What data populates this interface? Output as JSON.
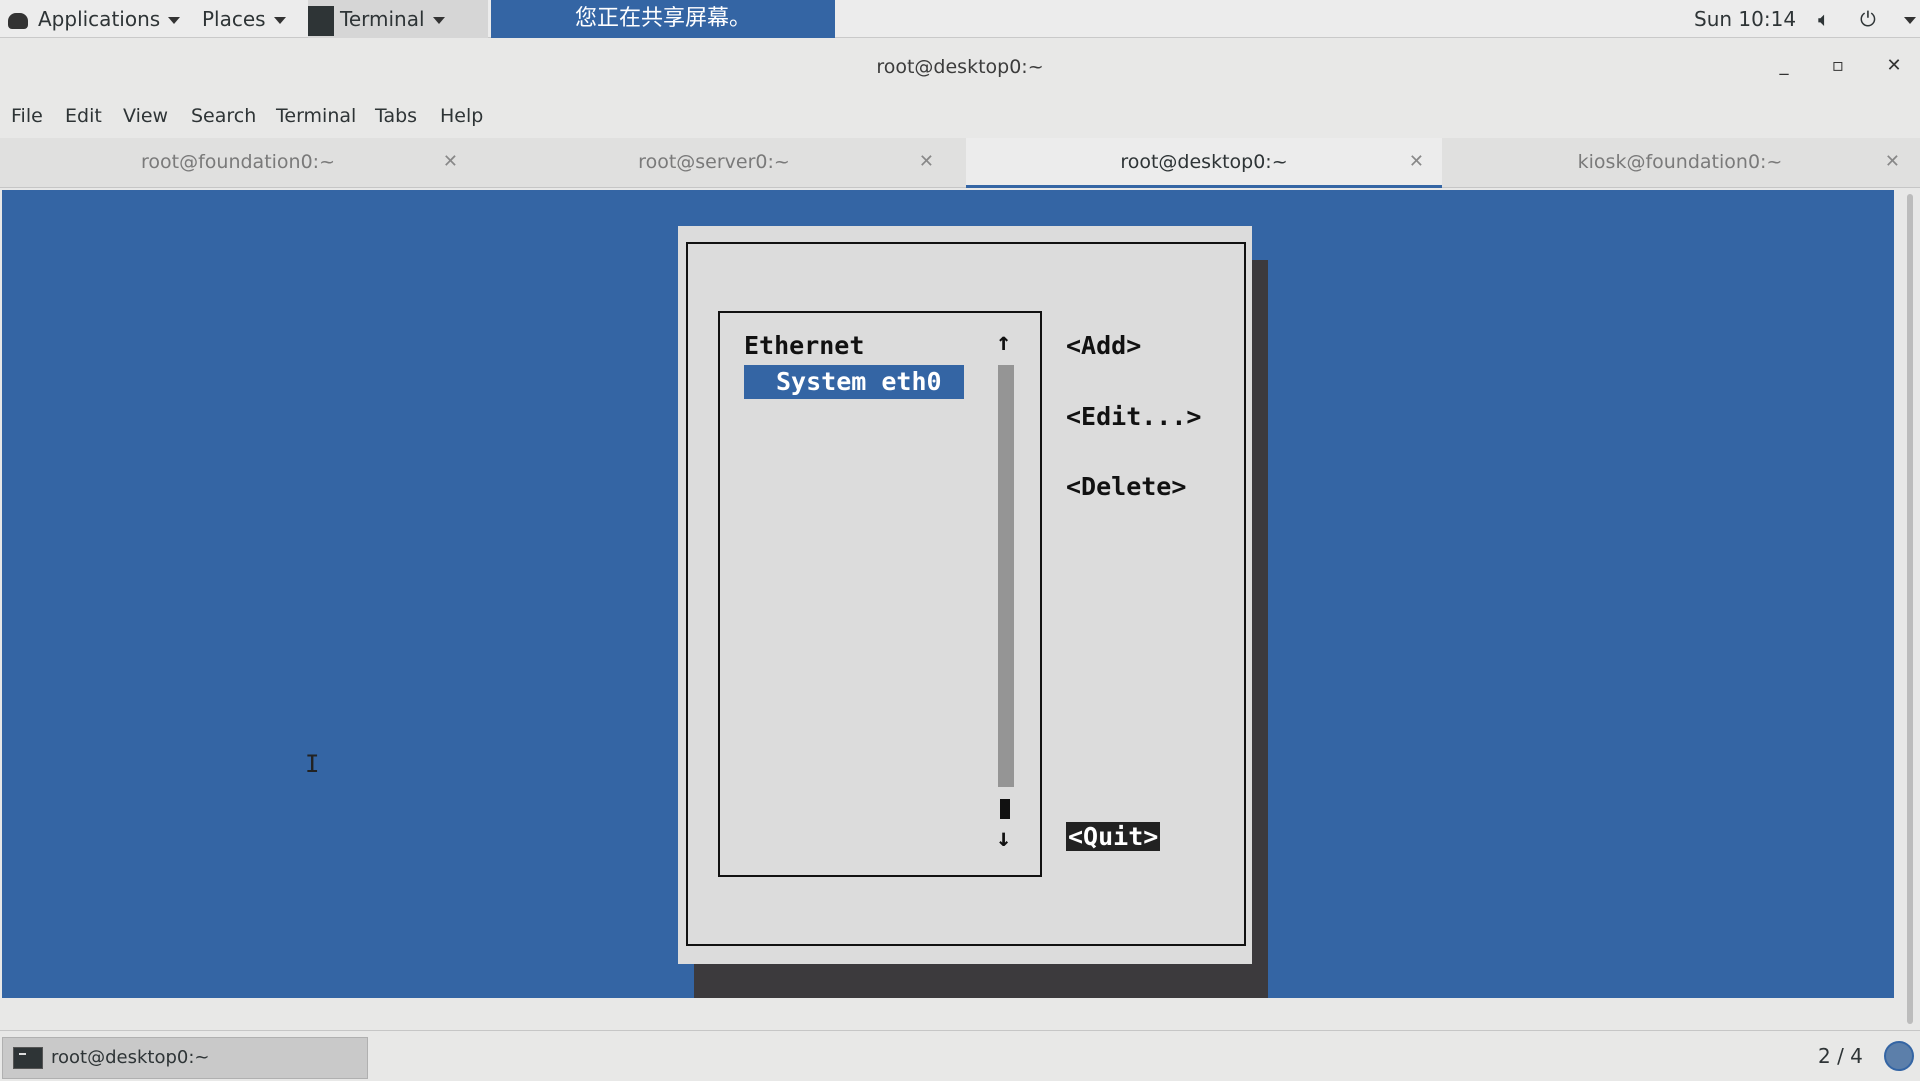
{
  "top_panel": {
    "applications": "Applications",
    "places": "Places",
    "terminal": "Terminal",
    "sharing_notice": "您正在共享屏幕。",
    "clock": "Sun 10:14"
  },
  "window": {
    "title": "root@desktop0:~"
  },
  "menubar": [
    "File",
    "Edit",
    "View",
    "Search",
    "Terminal",
    "Tabs",
    "Help"
  ],
  "tabs": [
    {
      "label": "root@foundation0:~",
      "active": false
    },
    {
      "label": "root@server0:~",
      "active": false
    },
    {
      "label": "root@desktop0:~",
      "active": true
    },
    {
      "label": "kiosk@foundation0:~",
      "active": false
    }
  ],
  "nmtui": {
    "list_heading": "Ethernet",
    "selected_connection": "System eth0",
    "arrow_up": "↑",
    "arrow_down": "↓",
    "buttons": {
      "add": "<Add>",
      "edit": "<Edit...>",
      "delete": "<Delete>",
      "quit": "<Quit>"
    }
  },
  "taskbar": {
    "task_label": "root@desktop0:~",
    "workspace": "2 / 4"
  },
  "colors": {
    "terminal_bg": "#3465a4",
    "dialog_bg": "#dcdcdc",
    "selected_bg": "#3465a4"
  }
}
